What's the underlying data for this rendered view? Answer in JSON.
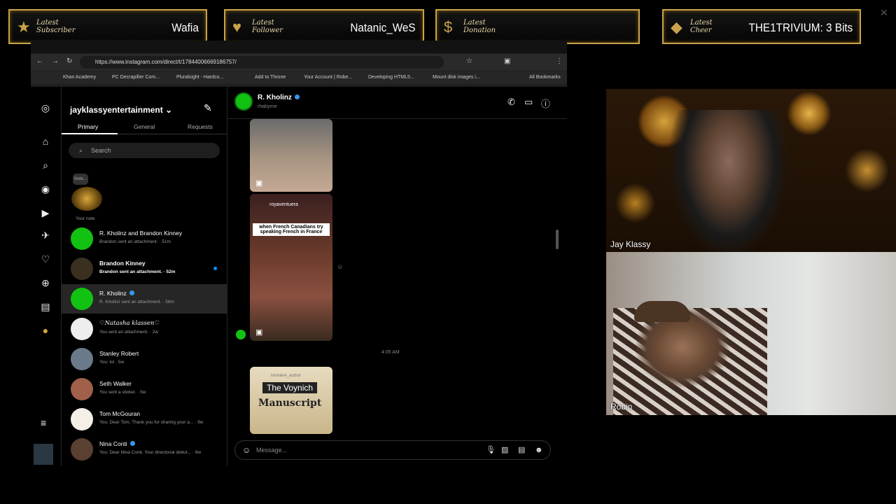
{
  "alerts": [
    {
      "label": "Latest Subscriber",
      "value": "Wafia"
    },
    {
      "label": "Latest Follower",
      "value": "Natanic_WeS"
    },
    {
      "label": "Latest Donation",
      "value": ""
    },
    {
      "label": "Latest Cheer",
      "value": "THE1TRIVIUM: 3 Bits"
    }
  ],
  "browser": {
    "url": "https://www.instagram.com/direct/t/17844006669186757/",
    "bookmarks": [
      "Khan Academy",
      "PC Decrapifier Com...",
      "Pluralsight - Hardco...",
      "Add to Throne",
      "Your Account | Robe...",
      "Developing HTML5...",
      "Mount disk images i...",
      "All Bookmarks"
    ]
  },
  "inbox": {
    "username": "jayklassyentertainment",
    "tabs": [
      "Primary",
      "General",
      "Requests"
    ],
    "search_placeholder": "Search",
    "note_label": "Note...",
    "your_note": "Your note",
    "conversations": [
      {
        "name": "R. Kholinz and Brandon Kinney",
        "preview": "Brandon sent an attachment. · 51m"
      },
      {
        "name": "Brandon Kinney",
        "preview": "Brandon sent an attachment. · 52m"
      },
      {
        "name": "R. Kholinz",
        "preview": "R. Kholinz sent an attachment. · 58m"
      },
      {
        "name": "♡Natasha klassen♡",
        "preview": "You sent an attachment. · 2w"
      },
      {
        "name": "Stanley Robert",
        "preview": "You: lol · 5w"
      },
      {
        "name": "Seth Walker",
        "preview": "You sent a sticker. · 5w"
      },
      {
        "name": "Tom McGouran",
        "preview": "You: Dear Tom, Thank you for sharing your a... · 9w"
      },
      {
        "name": "Nina Conti",
        "preview": "You: Dear Nina Conti, Your directorial debut... · 9w"
      }
    ]
  },
  "chat": {
    "name": "R. Kholinz",
    "handle": "rhabyrne",
    "reel2_author": "royaventuera",
    "reel2_caption": "when French Canadians try speaking French in France",
    "timestamp": "4:05 AM",
    "reel3_author": "imriviere_author",
    "reel3_title1": "The Voynich",
    "reel3_title2": "Manuscript",
    "composer_placeholder": "Message..."
  },
  "cams": [
    {
      "label": "Jay Klassy"
    },
    {
      "label": "Robin"
    }
  ]
}
